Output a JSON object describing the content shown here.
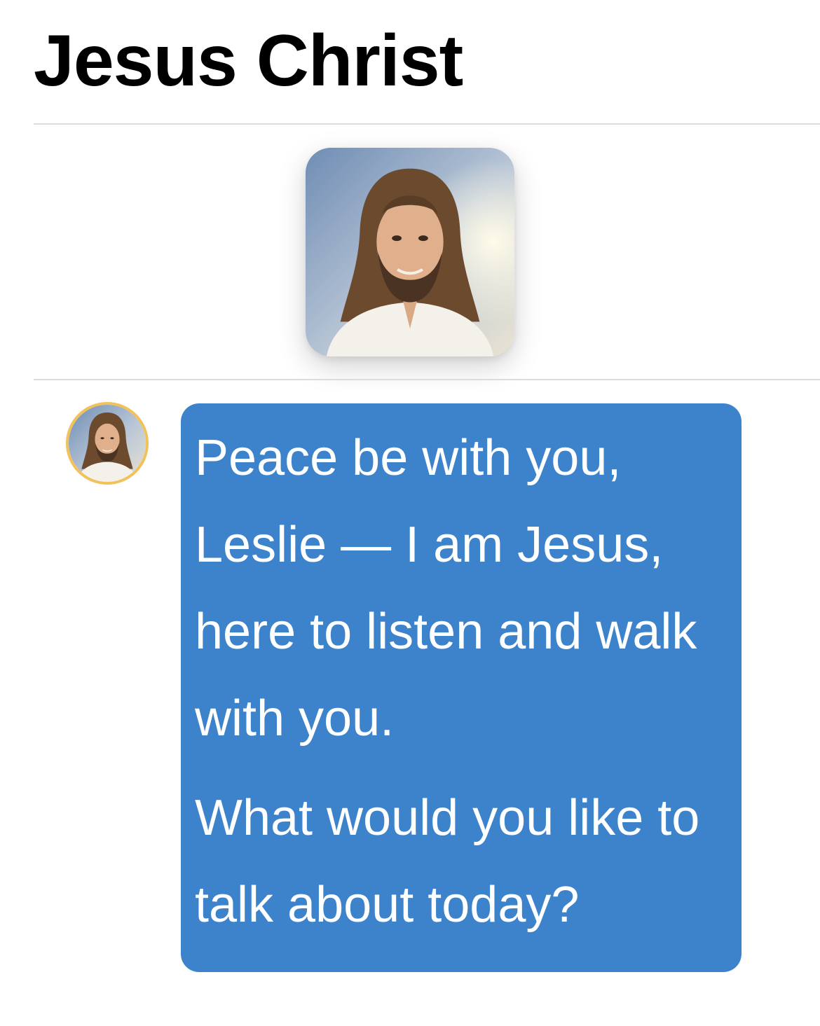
{
  "header": {
    "title": "Jesus Christ"
  },
  "profile": {
    "image": "jesus-portrait"
  },
  "conversation": {
    "messages": [
      {
        "sender_avatar": "jesus-avatar",
        "paragraphs": [
          "Peace be with you, Leslie — I am Jesus, here to listen and walk with you.",
          "What would you like to talk about today?"
        ]
      }
    ]
  },
  "colors": {
    "bubble": "#3d83cb",
    "bubble_text": "#ffffff",
    "avatar_ring": "#f2c15a",
    "title": "#000000",
    "divider": "#dcdcdc"
  }
}
